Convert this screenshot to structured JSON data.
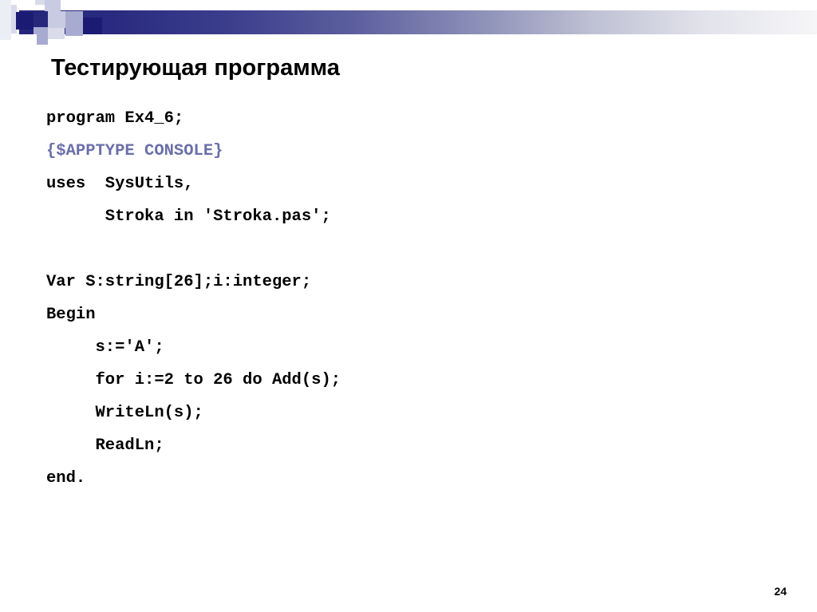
{
  "slide": {
    "title": "Тестирующая программа",
    "page_number": "24",
    "colors": {
      "banner_start": "#25267a",
      "banner_end": "#f6f6f8",
      "navy_square": "#1b1b73",
      "pale_square": "#c9cbe2",
      "comment_text": "#6a6fa8",
      "code_text": "#000000",
      "background": "#ffffff"
    }
  },
  "code": {
    "language": "pascal",
    "lines": [
      {
        "text": "program Ex4_6;",
        "style": "plain"
      },
      {
        "text": "{$APPTYPE CONSOLE}",
        "style": "comment"
      },
      {
        "text": "uses  SysUtils,",
        "style": "plain"
      },
      {
        "text": "      Stroka in 'Stroka.pas';",
        "style": "plain"
      },
      {
        "text": " ",
        "style": "blank"
      },
      {
        "text": "Var S:string[26];i:integer;",
        "style": "plain"
      },
      {
        "text": "Begin",
        "style": "plain"
      },
      {
        "text": "     s:='A';",
        "style": "plain"
      },
      {
        "text": "     for i:=2 to 26 do Add(s);",
        "style": "plain"
      },
      {
        "text": "     WriteLn(s);",
        "style": "plain"
      },
      {
        "text": "     ReadLn;",
        "style": "plain"
      },
      {
        "text": "end.",
        "style": "plain"
      }
    ]
  }
}
